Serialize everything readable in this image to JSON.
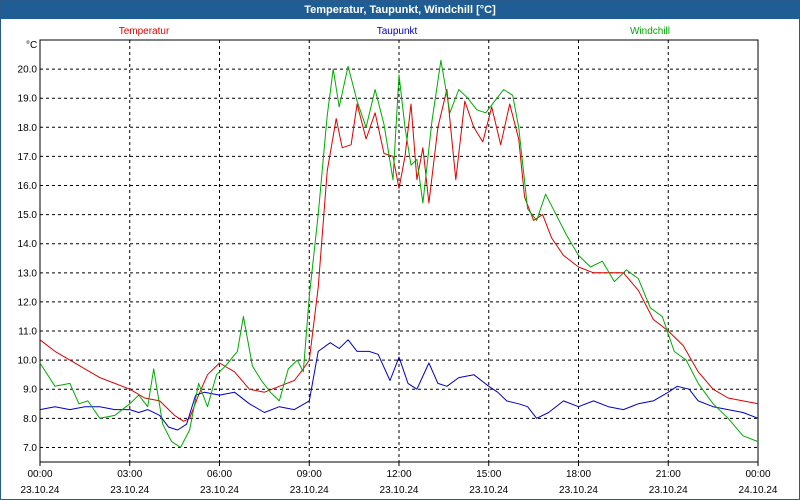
{
  "window": {
    "title": "Temperatur, Taupunkt, Windchill [°C]"
  },
  "colors": {
    "titlebar": "#1f5d95",
    "grid": "#000000",
    "axis": "#000000"
  },
  "chart_data": {
    "type": "line",
    "title": "Temperatur, Taupunkt, Windchill [°C]",
    "ylabel": "°C",
    "ylim": [
      6.5,
      21.0
    ],
    "yticks": [
      "7.0",
      "8.0",
      "9.0",
      "10.0",
      "11.0",
      "12.0",
      "13.0",
      "14.0",
      "15.0",
      "16.0",
      "17.0",
      "18.0",
      "19.0",
      "20.0"
    ],
    "xlim": [
      0,
      24
    ],
    "xticks": [
      {
        "time": "00:00",
        "date": "23.10.24"
      },
      {
        "time": "03:00",
        "date": "23.10.24"
      },
      {
        "time": "06:00",
        "date": "23.10.24"
      },
      {
        "time": "09:00",
        "date": "23.10.24"
      },
      {
        "time": "12:00",
        "date": "23.10.24"
      },
      {
        "time": "15:00",
        "date": "23.10.24"
      },
      {
        "time": "18:00",
        "date": "23.10.24"
      },
      {
        "time": "21:00",
        "date": "23.10.24"
      },
      {
        "time": "00:00",
        "date": "24.10.24"
      }
    ],
    "grid": true,
    "legend": "top",
    "series": [
      {
        "name": "Temperatur",
        "color": "#dd0000",
        "points": [
          [
            0,
            10.7
          ],
          [
            0.5,
            10.3
          ],
          [
            1,
            10.0
          ],
          [
            1.5,
            9.7
          ],
          [
            2,
            9.4
          ],
          [
            2.5,
            9.2
          ],
          [
            3,
            9.0
          ],
          [
            3.5,
            8.7
          ],
          [
            4,
            8.6
          ],
          [
            4.5,
            8.1
          ],
          [
            4.8,
            7.9
          ],
          [
            5,
            8.0
          ],
          [
            5.3,
            8.8
          ],
          [
            5.6,
            9.5
          ],
          [
            6,
            9.9
          ],
          [
            6.5,
            9.6
          ],
          [
            7,
            9.0
          ],
          [
            7.5,
            8.9
          ],
          [
            8,
            9.1
          ],
          [
            8.5,
            9.3
          ],
          [
            8.8,
            9.7
          ],
          [
            9.0,
            10.0
          ],
          [
            9.3,
            12.5
          ],
          [
            9.6,
            16.5
          ],
          [
            9.9,
            18.3
          ],
          [
            10.1,
            17.3
          ],
          [
            10.4,
            17.4
          ],
          [
            10.6,
            18.8
          ],
          [
            10.9,
            17.6
          ],
          [
            11.2,
            18.5
          ],
          [
            11.5,
            17.1
          ],
          [
            11.8,
            17.0
          ],
          [
            12.0,
            15.9
          ],
          [
            12.2,
            17.0
          ],
          [
            12.4,
            18.8
          ],
          [
            12.6,
            16.2
          ],
          [
            12.8,
            17.3
          ],
          [
            13.0,
            15.4
          ],
          [
            13.3,
            18.0
          ],
          [
            13.6,
            19.3
          ],
          [
            13.9,
            16.2
          ],
          [
            14.2,
            18.9
          ],
          [
            14.5,
            18.0
          ],
          [
            14.8,
            17.5
          ],
          [
            15.1,
            18.7
          ],
          [
            15.4,
            17.4
          ],
          [
            15.7,
            18.8
          ],
          [
            16.0,
            17.6
          ],
          [
            16.2,
            15.6
          ],
          [
            16.5,
            14.8
          ],
          [
            16.8,
            15.0
          ],
          [
            17.1,
            14.2
          ],
          [
            17.5,
            13.6
          ],
          [
            18.0,
            13.2
          ],
          [
            18.5,
            13.0
          ],
          [
            19.0,
            13.0
          ],
          [
            19.5,
            13.0
          ],
          [
            20.0,
            12.4
          ],
          [
            20.5,
            11.4
          ],
          [
            21.0,
            11.0
          ],
          [
            21.5,
            10.5
          ],
          [
            22.0,
            9.6
          ],
          [
            22.5,
            9.0
          ],
          [
            23.0,
            8.7
          ],
          [
            23.5,
            8.6
          ],
          [
            24,
            8.5
          ]
        ]
      },
      {
        "name": "Taupunkt",
        "color": "#0000cc",
        "points": [
          [
            0,
            8.3
          ],
          [
            0.5,
            8.4
          ],
          [
            1,
            8.3
          ],
          [
            1.5,
            8.4
          ],
          [
            2,
            8.4
          ],
          [
            2.5,
            8.3
          ],
          [
            3,
            8.3
          ],
          [
            3.3,
            8.2
          ],
          [
            3.6,
            8.3
          ],
          [
            4,
            8.1
          ],
          [
            4.3,
            7.7
          ],
          [
            4.6,
            7.6
          ],
          [
            4.9,
            7.8
          ],
          [
            5.2,
            8.8
          ],
          [
            5.5,
            8.9
          ],
          [
            6,
            8.8
          ],
          [
            6.5,
            8.9
          ],
          [
            7,
            8.5
          ],
          [
            7.5,
            8.2
          ],
          [
            8,
            8.4
          ],
          [
            8.5,
            8.3
          ],
          [
            9.0,
            8.6
          ],
          [
            9.3,
            10.3
          ],
          [
            9.7,
            10.6
          ],
          [
            10.0,
            10.4
          ],
          [
            10.3,
            10.7
          ],
          [
            10.6,
            10.3
          ],
          [
            11,
            10.3
          ],
          [
            11.3,
            10.2
          ],
          [
            11.7,
            9.3
          ],
          [
            12.0,
            10.1
          ],
          [
            12.3,
            9.2
          ],
          [
            12.6,
            9.0
          ],
          [
            13.0,
            9.9
          ],
          [
            13.3,
            9.2
          ],
          [
            13.6,
            9.1
          ],
          [
            14,
            9.4
          ],
          [
            14.5,
            9.5
          ],
          [
            15,
            9.1
          ],
          [
            15.3,
            8.9
          ],
          [
            15.6,
            8.6
          ],
          [
            16,
            8.5
          ],
          [
            16.3,
            8.4
          ],
          [
            16.6,
            8.0
          ],
          [
            17,
            8.2
          ],
          [
            17.5,
            8.6
          ],
          [
            18,
            8.4
          ],
          [
            18.5,
            8.6
          ],
          [
            19,
            8.4
          ],
          [
            19.5,
            8.3
          ],
          [
            20,
            8.5
          ],
          [
            20.5,
            8.6
          ],
          [
            21,
            8.9
          ],
          [
            21.3,
            9.1
          ],
          [
            21.7,
            9.0
          ],
          [
            22,
            8.6
          ],
          [
            22.5,
            8.4
          ],
          [
            23,
            8.3
          ],
          [
            23.5,
            8.2
          ],
          [
            24,
            8.0
          ]
        ]
      },
      {
        "name": "Windchill",
        "color": "#00aa00",
        "points": [
          [
            0,
            9.9
          ],
          [
            0.5,
            9.1
          ],
          [
            1,
            9.2
          ],
          [
            1.3,
            8.5
          ],
          [
            1.6,
            8.6
          ],
          [
            2,
            8.0
          ],
          [
            2.5,
            8.1
          ],
          [
            3,
            8.5
          ],
          [
            3.3,
            8.8
          ],
          [
            3.6,
            8.4
          ],
          [
            3.8,
            9.7
          ],
          [
            4.1,
            7.8
          ],
          [
            4.4,
            7.2
          ],
          [
            4.7,
            7.0
          ],
          [
            5.0,
            7.6
          ],
          [
            5.3,
            9.2
          ],
          [
            5.6,
            8.4
          ],
          [
            5.9,
            9.5
          ],
          [
            6.2,
            9.8
          ],
          [
            6.6,
            10.3
          ],
          [
            6.8,
            11.5
          ],
          [
            7.1,
            9.8
          ],
          [
            7.4,
            9.3
          ],
          [
            7.7,
            8.9
          ],
          [
            8.0,
            8.6
          ],
          [
            8.3,
            9.7
          ],
          [
            8.6,
            10.0
          ],
          [
            8.8,
            9.6
          ],
          [
            9.0,
            12.2
          ],
          [
            9.3,
            15.0
          ],
          [
            9.6,
            18.4
          ],
          [
            9.8,
            20.0
          ],
          [
            10.0,
            18.7
          ],
          [
            10.3,
            20.1
          ],
          [
            10.6,
            18.9
          ],
          [
            10.9,
            18.0
          ],
          [
            11.2,
            19.3
          ],
          [
            11.5,
            18.1
          ],
          [
            11.8,
            16.2
          ],
          [
            12.0,
            19.8
          ],
          [
            12.2,
            18.0
          ],
          [
            12.4,
            16.7
          ],
          [
            12.6,
            16.9
          ],
          [
            12.8,
            15.4
          ],
          [
            13.1,
            18.2
          ],
          [
            13.4,
            20.3
          ],
          [
            13.7,
            18.5
          ],
          [
            14.0,
            19.3
          ],
          [
            14.3,
            19.0
          ],
          [
            14.6,
            18.6
          ],
          [
            14.9,
            18.5
          ],
          [
            15.2,
            18.9
          ],
          [
            15.5,
            19.3
          ],
          [
            15.8,
            19.1
          ],
          [
            16.0,
            18.0
          ],
          [
            16.3,
            15.2
          ],
          [
            16.6,
            14.8
          ],
          [
            16.9,
            15.7
          ],
          [
            17.2,
            15.1
          ],
          [
            17.6,
            14.3
          ],
          [
            18.0,
            13.6
          ],
          [
            18.4,
            13.2
          ],
          [
            18.8,
            13.4
          ],
          [
            19.2,
            12.7
          ],
          [
            19.6,
            13.1
          ],
          [
            20.0,
            12.8
          ],
          [
            20.4,
            11.8
          ],
          [
            20.8,
            11.5
          ],
          [
            21.2,
            10.3
          ],
          [
            21.6,
            10.0
          ],
          [
            22.0,
            9.2
          ],
          [
            22.5,
            8.5
          ],
          [
            23.0,
            8.0
          ],
          [
            23.5,
            7.4
          ],
          [
            24,
            7.2
          ]
        ]
      }
    ]
  }
}
